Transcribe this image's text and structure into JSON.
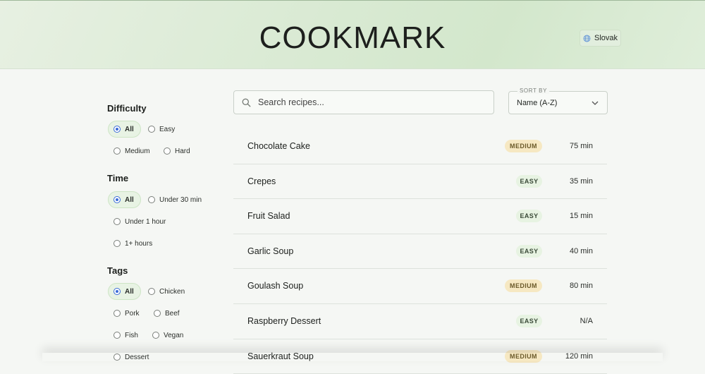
{
  "app": {
    "title": "COOKMARK"
  },
  "language": {
    "label": "Slovak",
    "icon": "globe-icon"
  },
  "filters": {
    "difficulty": {
      "title": "Difficulty",
      "options": [
        "All",
        "Easy",
        "Medium",
        "Hard"
      ],
      "selected": "All"
    },
    "time": {
      "title": "Time",
      "options": [
        "All",
        "Under 30 min",
        "Under 1 hour",
        "1+ hours"
      ],
      "selected": "All"
    },
    "tags": {
      "title": "Tags",
      "options": [
        "All",
        "Chicken",
        "Pork",
        "Beef",
        "Fish",
        "Vegan",
        "Dessert"
      ],
      "selected": "All"
    }
  },
  "search": {
    "placeholder": "Search recipes...",
    "value": "",
    "icon": "search-icon"
  },
  "sort": {
    "label": "SORT BY",
    "value": "Name (A-Z)",
    "icon": "chevron-down-icon"
  },
  "recipes": [
    {
      "name": "Chocolate Cake",
      "difficulty": "MEDIUM",
      "time": "75 min"
    },
    {
      "name": "Crepes",
      "difficulty": "EASY",
      "time": "35 min"
    },
    {
      "name": "Fruit Salad",
      "difficulty": "EASY",
      "time": "15 min"
    },
    {
      "name": "Garlic Soup",
      "difficulty": "EASY",
      "time": "40 min"
    },
    {
      "name": "Goulash Soup",
      "difficulty": "MEDIUM",
      "time": "80 min"
    },
    {
      "name": "Raspberry Dessert",
      "difficulty": "EASY",
      "time": "N/A"
    },
    {
      "name": "Sauerkraut Soup",
      "difficulty": "MEDIUM",
      "time": "120 min"
    }
  ],
  "colors": {
    "accent": "#3a6bd8",
    "header_bg": "#d9ead3",
    "badge_medium": "#f6e8c2",
    "badge_easy": "#e7f3e2"
  }
}
